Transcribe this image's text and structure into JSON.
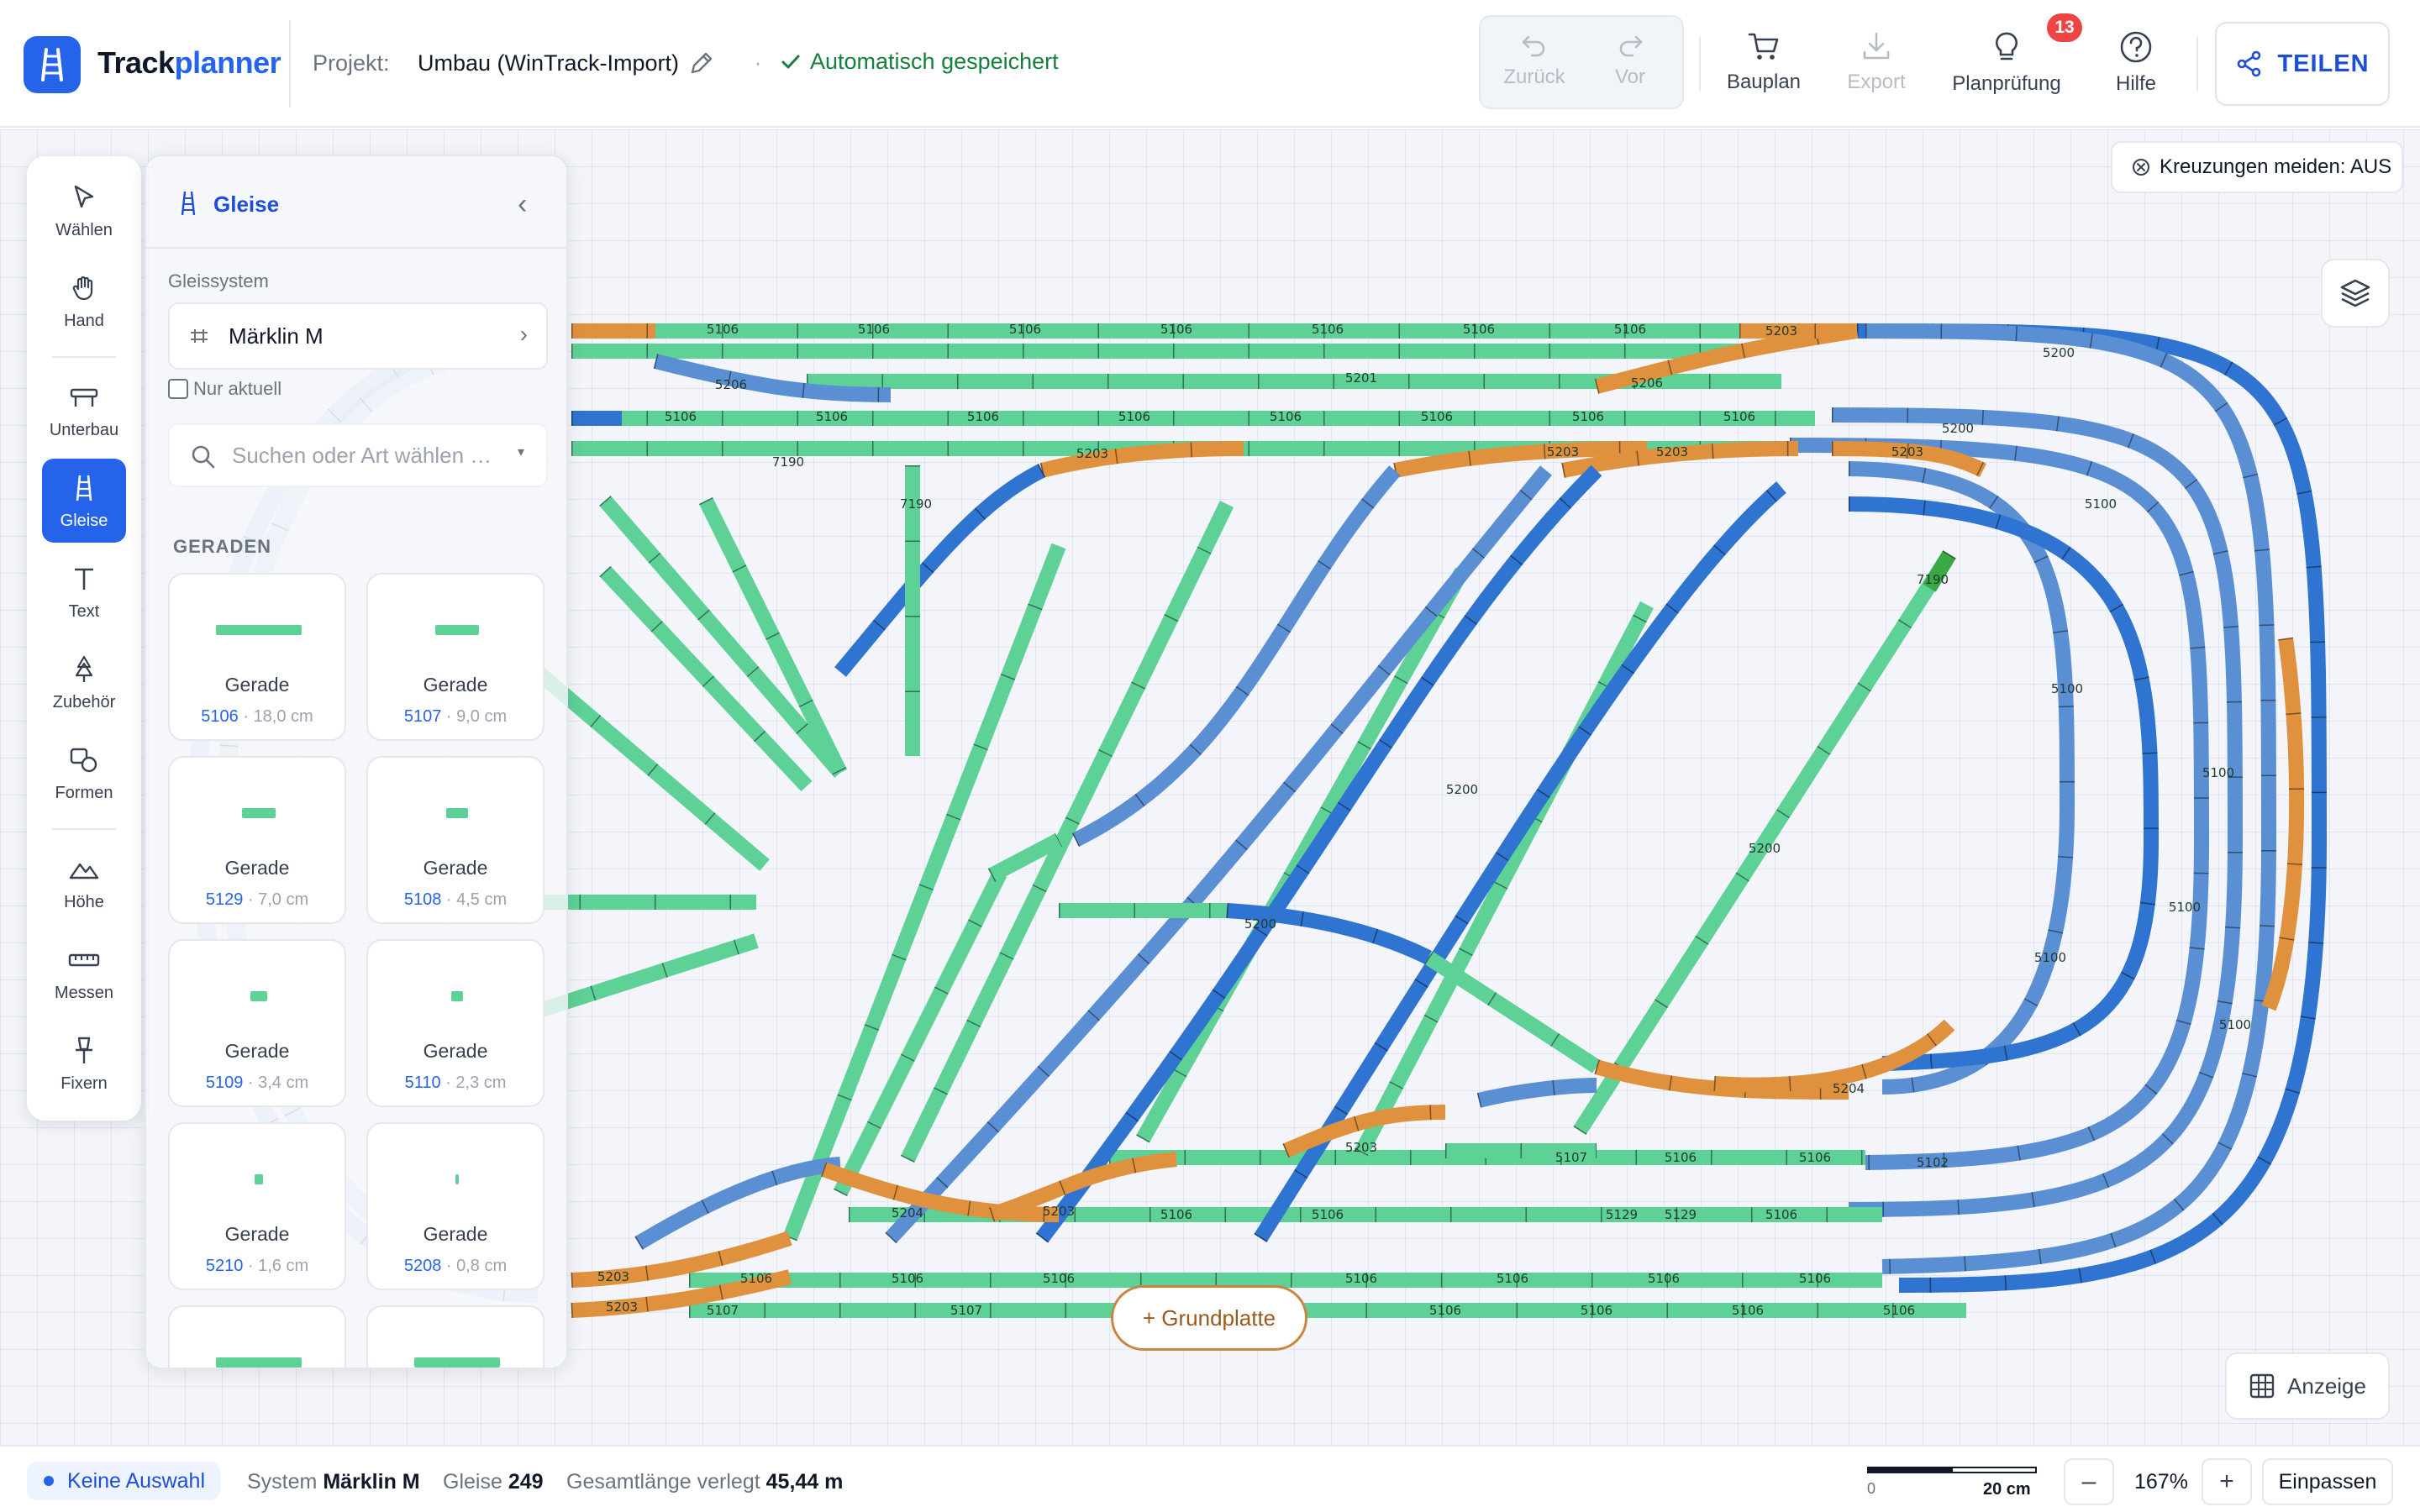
{
  "app": {
    "brand_prefix": "Track",
    "brand_suffix": "planner"
  },
  "header": {
    "project_label": "Projekt:",
    "project_name": "Umbau (WinTrack-Import)",
    "separator": "·",
    "save_status": "Automatisch gespeichert",
    "undo_label": "Zurück",
    "redo_label": "Vor",
    "bauplan_label": "Bauplan",
    "export_label": "Export",
    "planpruefung_label": "Planprüfung",
    "planpruefung_badge": "13",
    "hilfe_label": "Hilfe",
    "share_label": "TEILEN"
  },
  "tools": [
    {
      "label": "Wählen",
      "icon": "cursor-icon"
    },
    {
      "label": "Hand",
      "icon": "hand-icon"
    },
    {
      "label": "Unterbau",
      "icon": "substructure-icon"
    },
    {
      "label": "Gleise",
      "icon": "track-icon",
      "active": true
    },
    {
      "label": "Text",
      "icon": "text-icon"
    },
    {
      "label": "Zubehör",
      "icon": "accessory-icon"
    },
    {
      "label": "Formen",
      "icon": "shapes-icon"
    },
    {
      "label": "Höhe",
      "icon": "height-icon"
    },
    {
      "label": "Messen",
      "icon": "ruler-icon"
    },
    {
      "label": "Fixern",
      "icon": "pin-icon"
    }
  ],
  "panel": {
    "title": "Gleise",
    "system_label": "Gleissystem",
    "system_value": "Märklin M",
    "only_current_label": "Nur aktuell",
    "search_placeholder": "Suchen oder Art wählen …",
    "section_title": "GERADEN",
    "tiles": [
      {
        "name": "Gerade",
        "number": "5106",
        "length": "18,0 cm",
        "frac": 0.55
      },
      {
        "name": "Gerade",
        "number": "5107",
        "length": "9,0 cm",
        "frac": 0.28
      },
      {
        "name": "Gerade",
        "number": "5129",
        "length": "7,0 cm",
        "frac": 0.22
      },
      {
        "name": "Gerade",
        "number": "5108",
        "length": "4,5 cm",
        "frac": 0.14
      },
      {
        "name": "Gerade",
        "number": "5109",
        "length": "3,4 cm",
        "frac": 0.11
      },
      {
        "name": "Gerade",
        "number": "5110",
        "length": "2,3 cm",
        "frac": 0.07
      },
      {
        "name": "Gerade",
        "number": "5210",
        "length": "1,6 cm",
        "frac": 0.05
      },
      {
        "name": "Gerade",
        "number": "5208",
        "length": "0,8 cm",
        "frac": 0.025
      },
      {
        "name": "",
        "number": "",
        "length": "",
        "frac": 0.55
      },
      {
        "name": "",
        "number": "",
        "length": "",
        "frac": 0.55
      }
    ],
    "meta_sep": "·"
  },
  "canvas": {
    "avoid_crossings": "Kreuzungen meiden: AUS",
    "baseplate_button": "+ Grundplatte",
    "display_button": "Anzeige",
    "colors": {
      "straight": "#5ed196",
      "curve": "#5b8fd4",
      "curve_dark": "#2f74d0",
      "switch": "#e0913e",
      "end": "#3aa845"
    }
  },
  "status": {
    "selection": "Keine Auswahl",
    "system_label": "System",
    "system_value": "Märklin M",
    "tracks_label": "Gleise",
    "tracks_value": "249",
    "length_label": "Gesamtlänge verlegt",
    "length_value": "45,44 m",
    "scale_zero": "0",
    "scale_value": "20 cm",
    "zoom_out": "–",
    "zoom_value": "167%",
    "zoom_in": "+",
    "fit_label": "Einpassen"
  }
}
